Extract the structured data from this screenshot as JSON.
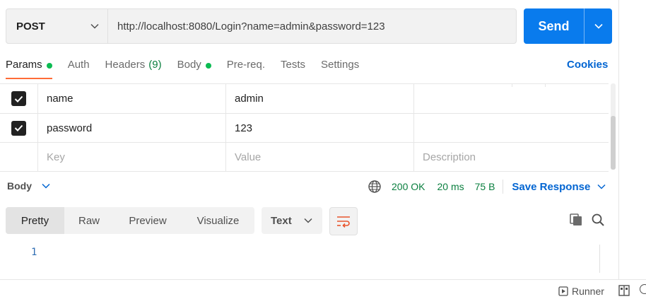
{
  "request": {
    "method": "POST",
    "url": "http://localhost:8080/Login?name=admin&password=123",
    "send_label": "Send"
  },
  "tabs": [
    {
      "label": "Params",
      "active": true,
      "dot": true
    },
    {
      "label": "Auth"
    },
    {
      "label": "Headers",
      "count": "(9)"
    },
    {
      "label": "Body",
      "dot": true
    },
    {
      "label": "Pre-req."
    },
    {
      "label": "Tests"
    },
    {
      "label": "Settings"
    }
  ],
  "cookies_label": "Cookies",
  "params": [
    {
      "checked": true,
      "key": "name",
      "value": "admin",
      "description": ""
    },
    {
      "checked": true,
      "key": "password",
      "value": "123",
      "description": ""
    }
  ],
  "params_placeholder": {
    "key": "Key",
    "value": "Value",
    "description": "Description"
  },
  "response": {
    "section_label": "Body",
    "status": "200 OK",
    "time": "20 ms",
    "size": "75 B",
    "save_label": "Save Response"
  },
  "view_tabs": [
    "Pretty",
    "Raw",
    "Preview",
    "Visualize"
  ],
  "format": "Text",
  "editor": {
    "line_number": "1"
  },
  "statusbar": {
    "runner_label": "Runner"
  },
  "colors": {
    "accent": "#ff6c37",
    "primary": "#097bed",
    "link": "#0265d2",
    "success": "#0a7f3f"
  }
}
